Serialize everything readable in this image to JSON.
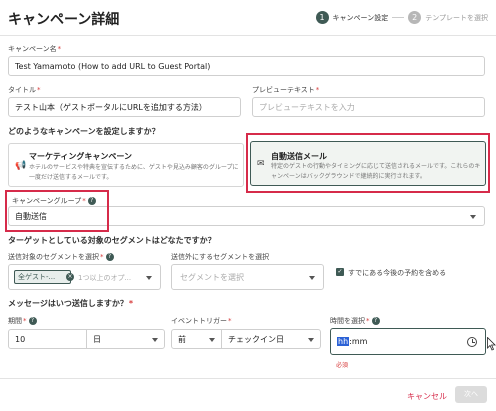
{
  "header": {
    "title": "キャンペーン詳細",
    "steps": [
      {
        "number": "1",
        "label": "キャンペーン設定",
        "state": "active"
      },
      {
        "number": "2",
        "label": "テンプレートを選択",
        "state": "inactive"
      }
    ]
  },
  "campaign_name": {
    "label": "キャンペーン名",
    "value": "Test Yamamoto (How to add URL to Guest Portal)"
  },
  "title_field": {
    "label": "タイトル",
    "value": "テスト山本（ゲストポータルにURLを追加する方法）"
  },
  "preview_text": {
    "label": "プレビューテキスト",
    "placeholder": "プレビューテキストを入力"
  },
  "campaign_type": {
    "question": "どのようなキャンペーンを設定しますか？",
    "options": [
      {
        "title": "マーケティングキャンペーン",
        "description": "ホテルのサービスや特典を宣伝するために、ゲストや見込み顧客のグループに一度だけ送信するメールです。",
        "icon": "megaphone-icon"
      },
      {
        "title": "自動送信メール",
        "description": "特定のゲストの行動やタイミングに応じて送信されるメールです。これらのキャンペーンはバックグラウンドで継続的に実行されます。",
        "icon": "envelope-icon",
        "selected": true
      }
    ]
  },
  "campaign_group": {
    "label": "キャンペーングループ",
    "value": "自動送信"
  },
  "segments": {
    "question": "ターゲットとしている対象のセグメントはどなたですか？",
    "include_label": "送信対象のセグメントを選択",
    "include_chip": "全ゲスト-...",
    "include_placeholder": "1つ以上のオプ...",
    "exclude_label": "送信外にするセグメントを選択",
    "exclude_placeholder": "セグメントを選択",
    "future_checkbox_label": "すでにある今後の予約を含める",
    "future_checked": true
  },
  "timing": {
    "question": "メッセージはいつ送信しますか？",
    "period_label": "期間",
    "period_value": "10",
    "period_unit": "日",
    "trigger_label": "イベントトリガー",
    "trigger_relation": "前",
    "trigger_event": "チェックイン日",
    "time_label": "時間を選択",
    "time_hh": "hh",
    "time_rest": ":mm",
    "time_error": "必須"
  },
  "footer": {
    "cancel_label": "キャンセル",
    "next_label": "次へ"
  },
  "colors": {
    "accent": "#3f5a55",
    "highlight": "#d62b4a",
    "error": "#d63b3b"
  }
}
